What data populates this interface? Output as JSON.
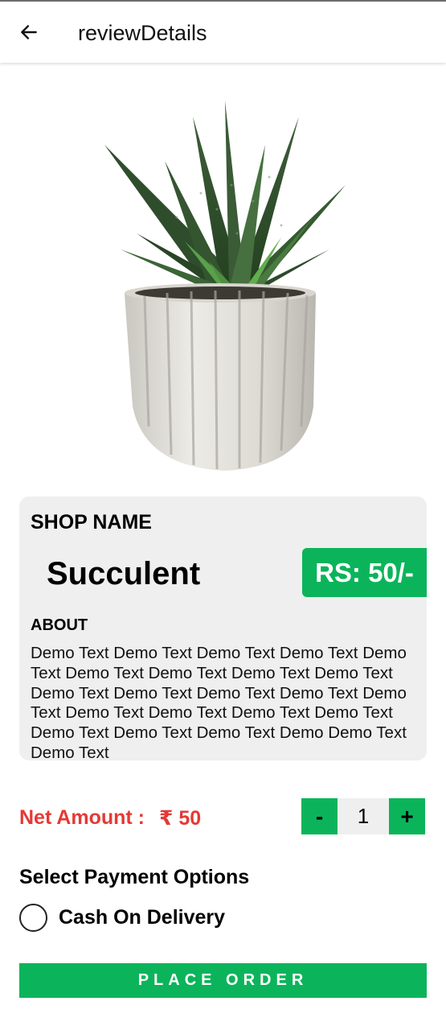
{
  "header": {
    "back_icon": "arrow-left-icon",
    "title": "reviewDetails"
  },
  "product": {
    "image_icon": "potted-succulent-image",
    "shop_label": "SHOP NAME",
    "name": "Succulent",
    "price": "RS: 50/-",
    "about_label": "ABOUT",
    "about_text": "Demo Text Demo Text Demo Text Demo Text Demo Text Demo Text Demo Text Demo Text Demo Text Demo Text Demo Text Demo Text Demo Text Demo Text Demo Text Demo Text Demo Text Demo Text Demo Text Demo Text Demo Text Demo Demo Text Demo Text"
  },
  "order": {
    "net_amount_label": "Net Amount :",
    "net_amount_value": "₹ 50",
    "decrement_label": "-",
    "quantity": "1",
    "increment_label": "+"
  },
  "payment": {
    "title": "Select Payment Options",
    "options": [
      {
        "label": "Cash On Delivery",
        "selected": false
      }
    ]
  },
  "actions": {
    "place_order": "PLACE ORDER"
  },
  "colors": {
    "accent_green": "#0bb45a",
    "net_amount_red": "#e53935",
    "card_background": "#efefef"
  }
}
